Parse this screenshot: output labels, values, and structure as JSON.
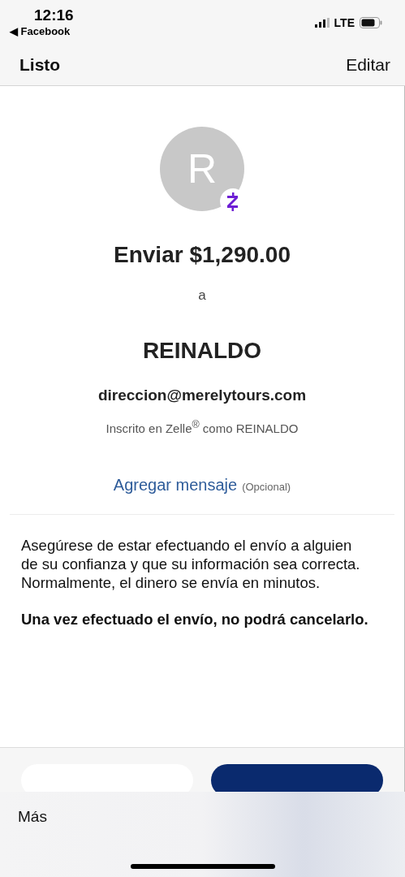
{
  "status_bar": {
    "time": "12:16",
    "back_app": "◀ Facebook",
    "network": "LTE"
  },
  "nav_bar": {
    "left": "Listo",
    "right": "Editar"
  },
  "recipient": {
    "initial": "R",
    "title": "Enviar $1,290.00",
    "connector": "a",
    "name": "REINALDO",
    "email": "direccion@merelytours.com",
    "enrolled": "Inscrito en Zelle$^{®}$ como REINALDO"
  },
  "message_link": {
    "label": "Agregar mensaje",
    "hint": "(Opcional)"
  },
  "notices": [
    {
      "text": "Asegúrese de estar efectuando el envío a alguien de su confianza y que su información sea correcta. Normalmente, el dinero se envía en minutos.",
      "bold": false
    },
    {
      "text": "Una vez efectuado el envío, no podrá cancelarlo.",
      "bold": true
    }
  ],
  "bottom_sheet": {
    "label": "Más"
  }
}
